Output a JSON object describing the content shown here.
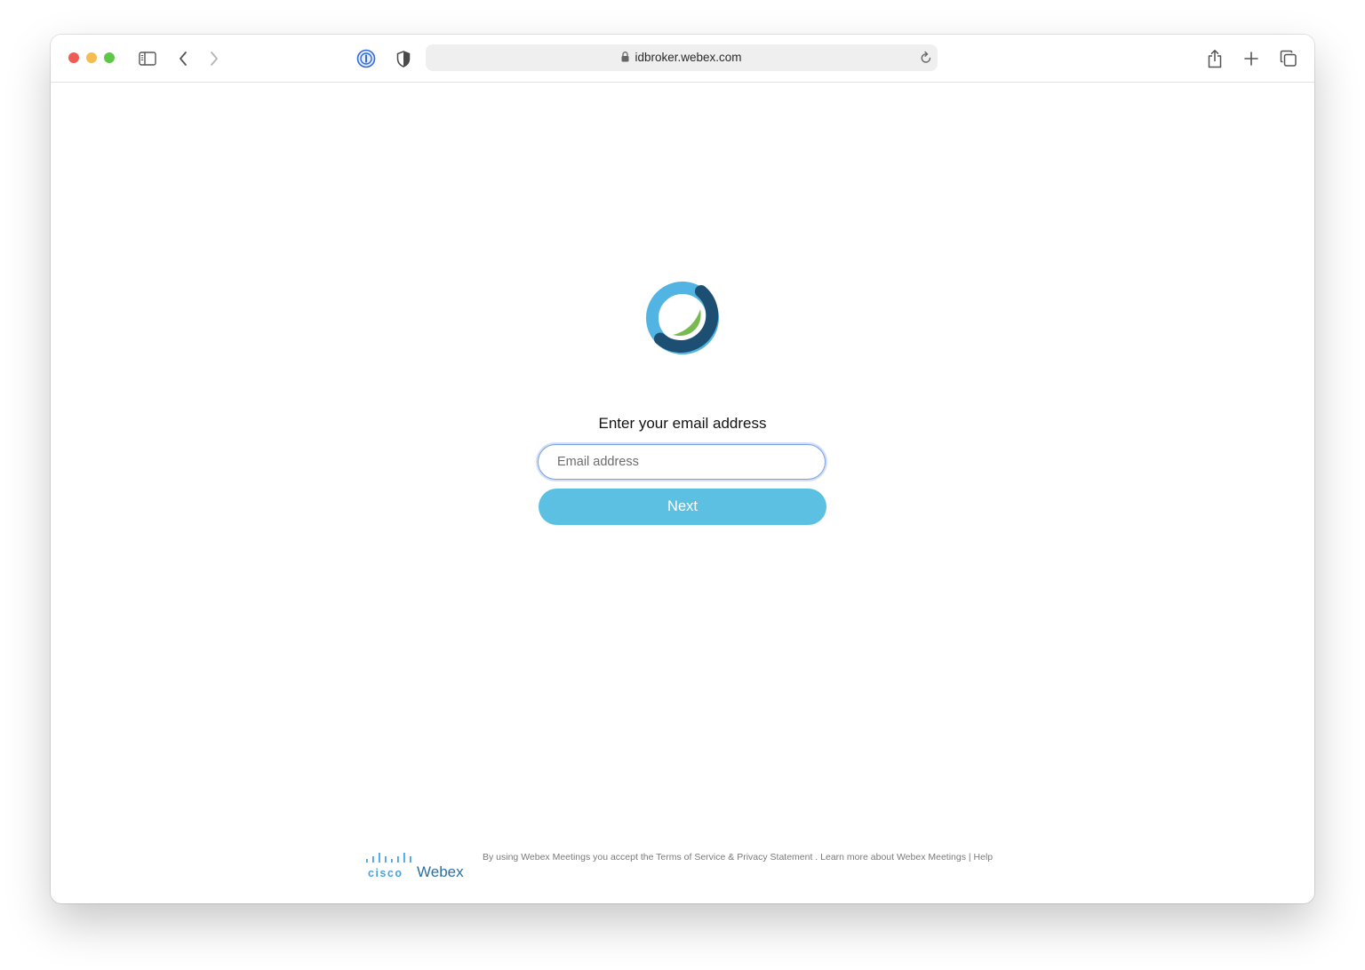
{
  "browser": {
    "url_text": "idbroker.webex.com",
    "traffic_lights": {
      "close": "#ee5c54",
      "minimize": "#f5bd4f",
      "zoom": "#5ec748"
    },
    "icons": [
      "sidebar-icon",
      "back-icon",
      "forward-icon",
      "password-manager-icon",
      "privacy-shield-icon",
      "lock-icon",
      "reload-icon",
      "share-icon",
      "new-tab-icon",
      "tab-overview-icon"
    ]
  },
  "login": {
    "heading": "Enter your email address",
    "email_placeholder": "Email address",
    "email_value": "",
    "next_label": "Next",
    "colors": {
      "button": "#5bc0e2",
      "logo_light_blue": "#51b4e3",
      "logo_dark_blue": "#1d4f73",
      "logo_green": "#77bb4f"
    }
  },
  "footer": {
    "brand_cisco": "cisco",
    "brand_webex": "Webex",
    "text_prefix": "By using Webex Meetings you accept the ",
    "terms_link": "Terms of Service",
    "amp": " & ",
    "privacy_link": "Privacy Statement",
    "text_middle": " . ",
    "learn_more_link": "Learn more about Webex Meetings",
    "separator": " | ",
    "help_link": "Help"
  }
}
